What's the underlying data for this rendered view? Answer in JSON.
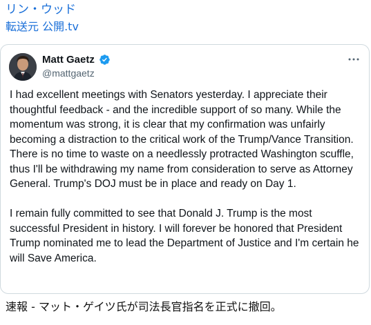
{
  "header": {
    "author_link": "リン・ウッド",
    "source_link": "転送元 公開.tv"
  },
  "tweet": {
    "display_name": "Matt Gaetz",
    "handle": "@mattgaetz",
    "paragraphs": [
      "I had excellent meetings with Senators yesterday.  I appreciate their thoughtful feedback - and the incredible support of so many.  While the momentum was strong, it is clear that my confirmation was unfairly becoming a distraction to the critical work of the Trump/Vance Transition.  There is no time to waste on a needlessly protracted Washington scuffle, thus I'll be withdrawing my name from consideration to serve as Attorney General.  Trump's DOJ must be in place and ready on Day 1.",
      "I remain fully committed to see that Donald J. Trump is the most successful President in history.  I will forever be honored that President Trump nominated me to lead the Department of Justice and I'm certain he will Save America."
    ],
    "verified_color": "#1d9bf0",
    "more_icon": "more-horizontal-icon"
  },
  "caption": "速報 - マット・ゲイツ氏が司法長官指名を正式に撤回。",
  "colors": {
    "link": "#1a6fd8",
    "text": "#0f1419",
    "secondary": "#536471",
    "border": "#cfd9de"
  }
}
